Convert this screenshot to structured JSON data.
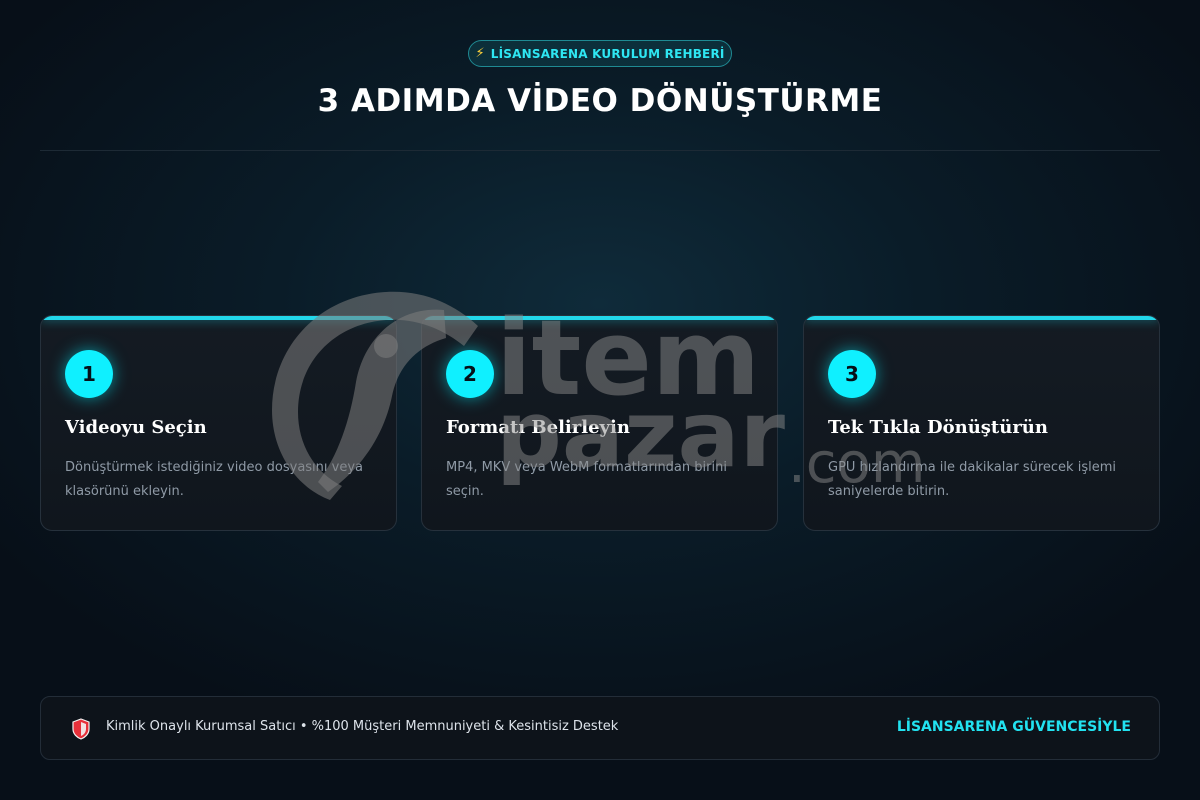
{
  "header": {
    "badge_icon": "lightning-icon",
    "badge_text": "LİSANSARENA KURULUM REHBERİ",
    "title": "3 ADIMDA VİDEO DÖNÜŞTÜRME"
  },
  "steps": [
    {
      "number": "1",
      "title": "Videoyu Seçin",
      "description": "Dönüştürmek istediğiniz video dosyasını veya klasörünü ekleyin."
    },
    {
      "number": "2",
      "title": "Formatı Belirleyin",
      "description": "MP4, MKV veya WebM formatlarından birini seçin."
    },
    {
      "number": "3",
      "title": "Tek Tıkla Dönüştürün",
      "description": "GPU hızlandırma ile dakikalar sürecek işlemi saniyelerde bitirin."
    }
  ],
  "watermark": {
    "line1": "item",
    "line2": "pazar",
    "suffix": ".com"
  },
  "footer": {
    "icon": "shield-icon",
    "text": "Kimlik Onaylı Kurumsal Satıcı • %100 Müşteri Memnuniyeti & Kesintisiz Destek",
    "brand": "LİSANSARENA GÜVENCESİYLE"
  },
  "colors": {
    "accent": "#0ff0ff",
    "background": "#070f18",
    "card": "#121920",
    "bolt": "#ffd23a",
    "shield": "#e8303a"
  }
}
